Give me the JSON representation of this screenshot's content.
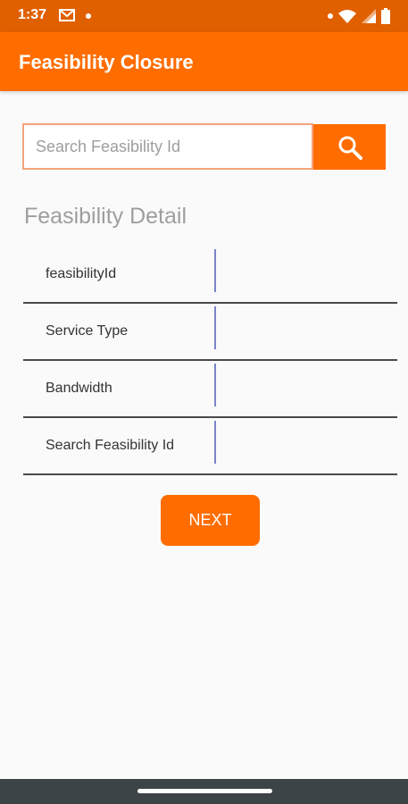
{
  "status_bar": {
    "time": "1:37",
    "left_icons": [
      "mail-icon",
      "notification-dot-icon"
    ],
    "right_icons": [
      "notification-dot-icon",
      "wifi-icon",
      "signal-icon",
      "battery-icon"
    ]
  },
  "app_bar": {
    "title": "Feasibility Closure"
  },
  "search": {
    "placeholder": "Search Feasibility Id",
    "value": "",
    "button_icon": "search-icon"
  },
  "detail": {
    "title": "Feasibility Detail",
    "rows": [
      {
        "label": "feasibilityId",
        "value": ""
      },
      {
        "label": "Service Type",
        "value": ""
      },
      {
        "label": "Bandwidth",
        "value": ""
      },
      {
        "label": "Search Feasibility Id",
        "value": ""
      }
    ]
  },
  "next_button": {
    "label": "NEXT"
  },
  "colors": {
    "status_bar": "#e06000",
    "app_bar": "#ff6d00",
    "accent": "#ff6d00",
    "search_border": "#f4a27a",
    "divider": "#7b83c9",
    "nav_bar": "#3d4447"
  }
}
